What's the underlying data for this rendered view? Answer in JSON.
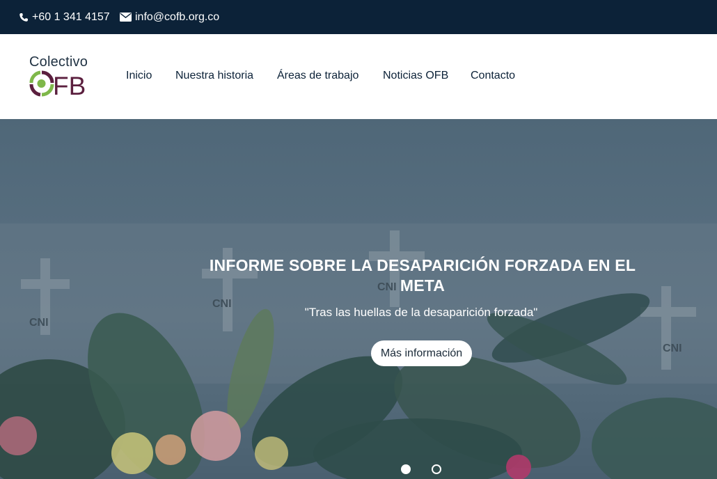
{
  "topbar": {
    "phone": "+60 1 341 4157",
    "email": "info@cofb.org.co"
  },
  "logo": {
    "word": "Colectivo",
    "letters": "FB",
    "colors": {
      "text": "#1f3142",
      "mark_green": "#7fb84a",
      "mark_purple": "#5b1f3e"
    }
  },
  "nav": {
    "items": [
      {
        "label": "Inicio"
      },
      {
        "label": "Nuestra historia"
      },
      {
        "label": "Áreas de trabajo"
      },
      {
        "label": "Noticias OFB"
      },
      {
        "label": "Contacto"
      }
    ]
  },
  "hero": {
    "title": "INFORME SOBRE LA DESAPARICIÓN FORZADA EN EL META",
    "subtitle": "\"Tras las huellas de la desaparición forzada\"",
    "button_label": "Más información",
    "slides_total": 2,
    "active_slide": 1,
    "art_text": "CNI"
  },
  "colors": {
    "topbar_bg": "#0c2238",
    "nav_text": "#0c2238",
    "hero_overlay": "#566d7e"
  }
}
